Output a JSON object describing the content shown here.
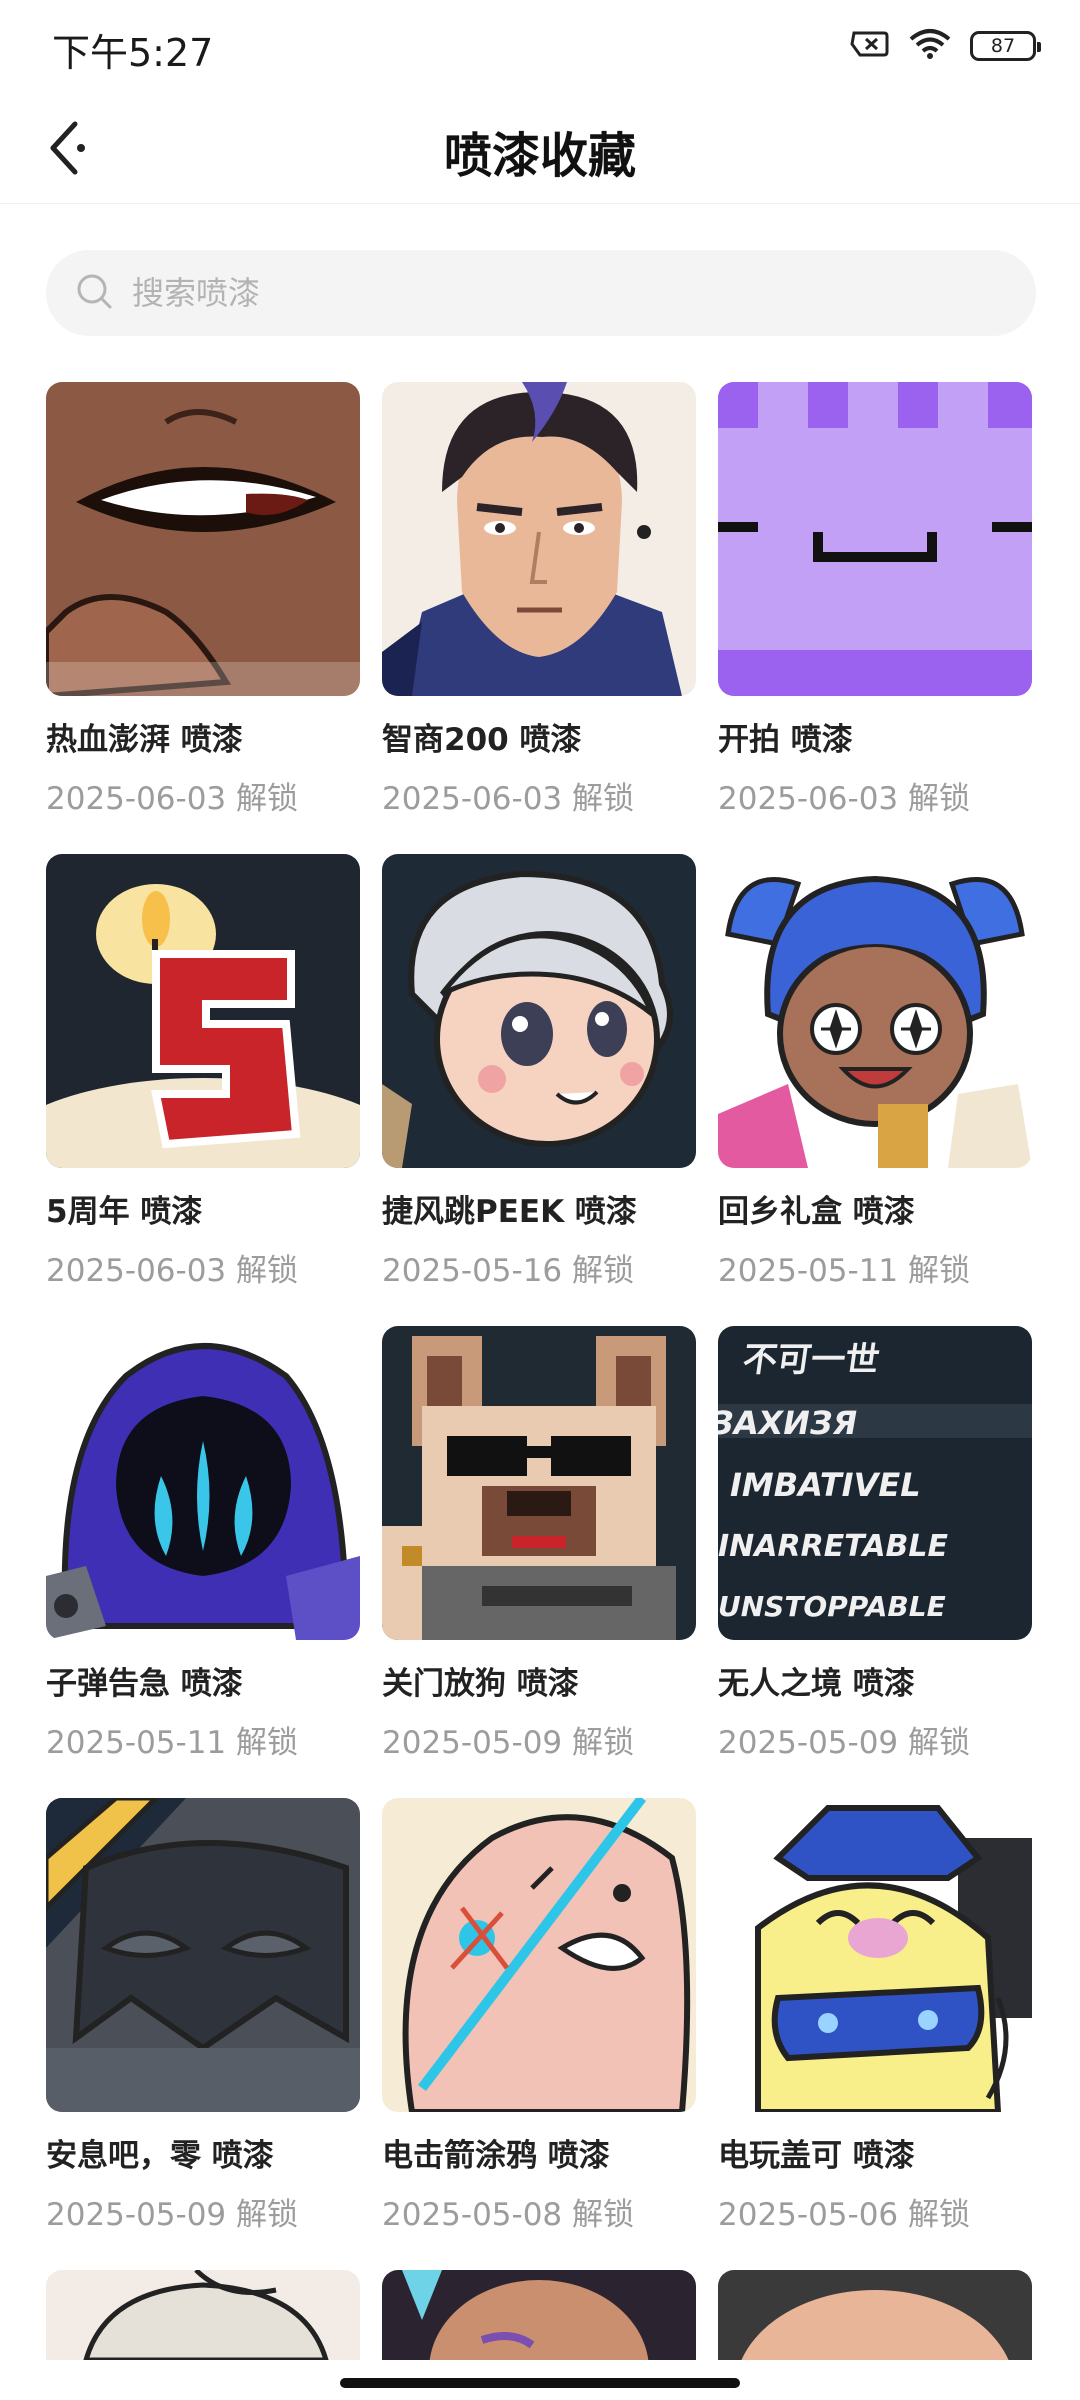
{
  "status_bar": {
    "time": "下午5:27",
    "battery": "87"
  },
  "nav": {
    "title": "喷漆收藏",
    "back_icon": "chevron-left-icon"
  },
  "search": {
    "placeholder": "搜索喷漆",
    "value": ""
  },
  "sprays": [
    {
      "name": "热血澎湃 喷漆",
      "unlock": "2025-06-03 解锁",
      "art": "grin"
    },
    {
      "name": "智商200 喷漆",
      "unlock": "2025-06-03 解锁",
      "art": "agent"
    },
    {
      "name": "开拍 喷漆",
      "unlock": "2025-06-03 解锁",
      "art": "purple"
    },
    {
      "name": "5周年 喷漆",
      "unlock": "2025-06-03 解锁",
      "art": "cake"
    },
    {
      "name": "捷风跳PEEK 喷漆",
      "unlock": "2025-05-16 解锁",
      "art": "jett"
    },
    {
      "name": "回乡礼盒 喷漆",
      "unlock": "2025-05-11 解锁",
      "art": "neon"
    },
    {
      "name": "子弹告急 喷漆",
      "unlock": "2025-05-11 解锁",
      "art": "hood"
    },
    {
      "name": "关门放狗 喷漆",
      "unlock": "2025-05-09 解锁",
      "art": "dog"
    },
    {
      "name": "无人之境 喷漆",
      "unlock": "2025-05-09 解锁",
      "art": "text"
    },
    {
      "name": "安息吧，零 喷漆",
      "unlock": "2025-05-09 解锁",
      "art": "mask"
    },
    {
      "name": "电击箭涂鸦 喷漆",
      "unlock": "2025-05-08 解锁",
      "art": "pink"
    },
    {
      "name": "电玩盖可 喷漆",
      "unlock": "2025-05-06 解锁",
      "art": "gamer"
    }
  ],
  "spray_text_art": [
    "不可一世",
    "IMBATIVEL",
    "INARRETABLE",
    "UNSTOPPABLE"
  ]
}
